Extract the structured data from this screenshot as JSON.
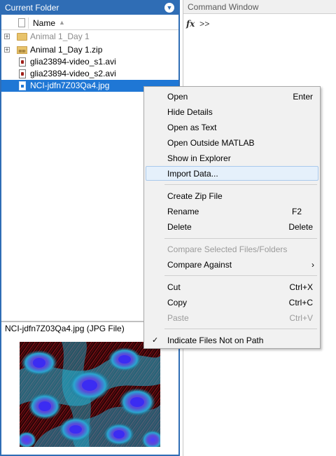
{
  "current_folder": {
    "title": "Current Folder",
    "menu_icon": "chevron-down-circle-icon",
    "column_header": "Name",
    "sort_icon": "sort-ascending-icon",
    "files": [
      {
        "name": "Animal 1_Day 1",
        "type": "folder",
        "expandable": true,
        "dimmed": true,
        "selected": false
      },
      {
        "name": "Animal 1_Day 1.zip",
        "type": "zip",
        "expandable": true,
        "dimmed": false,
        "selected": false
      },
      {
        "name": "glia23894-video_s1.avi",
        "type": "avi",
        "expandable": false,
        "dimmed": false,
        "selected": false
      },
      {
        "name": "glia23894-video_s2.avi",
        "type": "avi",
        "expandable": false,
        "dimmed": false,
        "selected": false
      },
      {
        "name": "NCI-jdfn7Z03Qa4.jpg",
        "type": "jpg",
        "expandable": false,
        "dimmed": false,
        "selected": true
      }
    ],
    "details_title": "NCI-jdfn7Z03Qa4.jpg  (JPG File)"
  },
  "command_window": {
    "title": "Command Window",
    "fx_icon": "fx",
    "prompt": ">>"
  },
  "context_menu": {
    "items": [
      {
        "label": "Open",
        "shortcut": "Enter"
      },
      {
        "label": "Hide Details",
        "shortcut": ""
      },
      {
        "label": "Open as Text",
        "shortcut": ""
      },
      {
        "label": "Open Outside MATLAB",
        "shortcut": ""
      },
      {
        "label": "Show in Explorer",
        "shortcut": ""
      },
      {
        "label": "Import Data...",
        "shortcut": "",
        "hovered": true
      },
      {
        "label": "Create Zip File",
        "shortcut": ""
      },
      {
        "label": "Rename",
        "shortcut": "F2"
      },
      {
        "label": "Delete",
        "shortcut": "Delete"
      },
      {
        "label": "Compare Selected Files/Folders",
        "shortcut": "",
        "disabled": true
      },
      {
        "label": "Compare Against",
        "shortcut": "",
        "submenu": true
      },
      {
        "label": "Cut",
        "shortcut": "Ctrl+X"
      },
      {
        "label": "Copy",
        "shortcut": "Ctrl+C"
      },
      {
        "label": "Paste",
        "shortcut": "Ctrl+V",
        "disabled": true
      },
      {
        "label": "Indicate Files Not on Path",
        "shortcut": "",
        "checked": true
      }
    ]
  },
  "colors": {
    "panel_title_bg": "#2f6db5",
    "selection": "#1f77d5",
    "menu_bg": "#f1f1f1",
    "menu_hover": "#e5f0fb"
  }
}
